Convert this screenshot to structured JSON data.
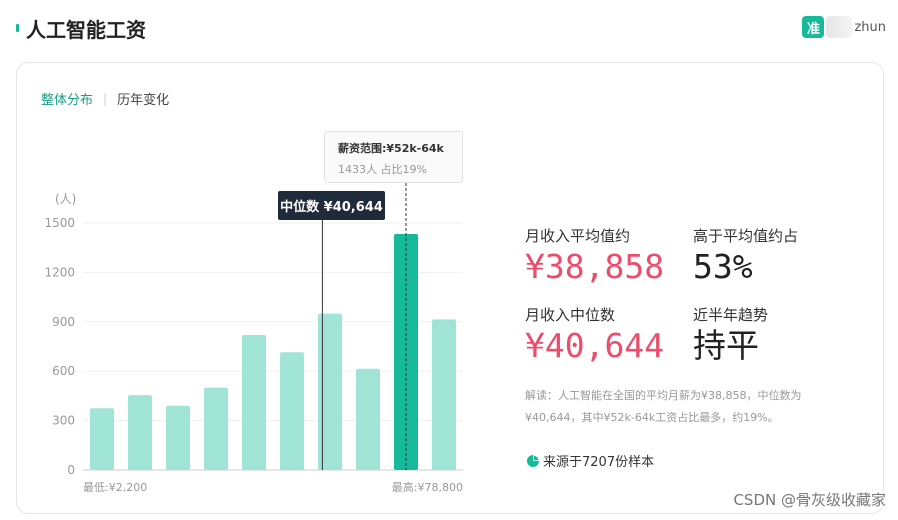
{
  "header": {
    "title": "人工智能工资",
    "brand_logo": "准",
    "brand_text": "zhun"
  },
  "tabs": [
    {
      "label": "整体分布",
      "active": true
    },
    {
      "label": "历年变化",
      "active": false
    }
  ],
  "tab_separator": "|",
  "tooltip": {
    "title": "薪资范围:¥52k-64k",
    "subtitle": "1433人  占比19%"
  },
  "median_tag": "中位数 ¥40,644",
  "stats": {
    "avg_label": "月收入平均值约",
    "avg_value": "¥38,858",
    "above_label": "高于平均值约占",
    "above_value": "53%",
    "median_label": "月收入中位数",
    "median_value": "¥40,644",
    "trend_label": "近半年趋势",
    "trend_value": "持平"
  },
  "note": "解读：人工智能在全国的平均月薪为¥38,858，中位数为¥40,644，其中¥52k-64k工资占比最多，约19%。",
  "source": "来源于7207份样本",
  "watermark": "CSDN @骨灰级收藏家",
  "colors": {
    "accent": "#16b998",
    "bar": "#a0e4d6",
    "bar_highlight": "#16b998",
    "red": "#ec4d6c"
  },
  "chart_data": {
    "type": "bar",
    "ylabel": "(人)",
    "ylim": [
      0,
      1500
    ],
    "yticks": [
      0,
      300,
      600,
      900,
      1200,
      1500
    ],
    "x_min_label": "最低:¥2,200",
    "x_max_label": "最高:¥78,800",
    "values": [
      375,
      455,
      390,
      500,
      820,
      715,
      950,
      615,
      1433,
      915
    ],
    "highlight_index": 8,
    "median_position": 6.3,
    "grid": true
  }
}
